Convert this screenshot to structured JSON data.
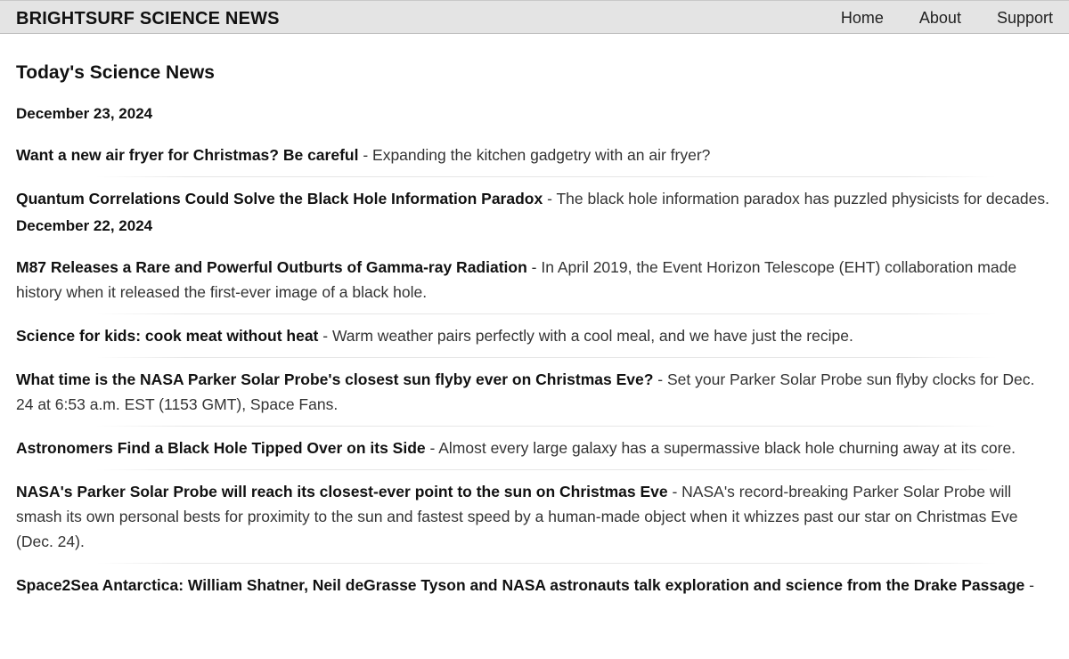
{
  "header": {
    "brand": "BRIGHTSURF SCIENCE NEWS",
    "nav": [
      "Home",
      "About",
      "Support"
    ]
  },
  "main": {
    "title": "Today's Science News",
    "groups": [
      {
        "date": "December 23, 2024",
        "articles": [
          {
            "title": "Want a new air fryer for Christmas? Be careful",
            "summary": " - Expanding the kitchen gadgetry with an air fryer?"
          },
          {
            "title": "Quantum Correlations Could Solve the Black Hole Information Paradox",
            "summary": " - The black hole information paradox has puzzled physicists for decades."
          }
        ]
      },
      {
        "date": "December 22, 2024",
        "articles": [
          {
            "title": "M87 Releases a Rare and Powerful Outburts of Gamma-ray Radiation",
            "summary": " - In April 2019, the Event Horizon Telescope (EHT) collaboration made history when it released the first-ever image of a black hole."
          },
          {
            "title": "Science for kids: cook meat without heat",
            "summary": " - Warm weather pairs perfectly with a cool meal, and we have just the recipe."
          },
          {
            "title": "What time is the NASA Parker Solar Probe's closest sun flyby ever on Christmas Eve?",
            "summary": " - Set your Parker Solar Probe sun flyby clocks for Dec. 24 at 6:53 a.m. EST (1153 GMT), Space Fans."
          },
          {
            "title": "Astronomers Find a Black Hole Tipped Over on its Side",
            "summary": " - Almost every large galaxy has a supermassive black hole churning away at its core."
          },
          {
            "title": "NASA's Parker Solar Probe will reach its closest-ever point to the sun on Christmas Eve",
            "summary": " - NASA's record-breaking Parker Solar Probe will smash its own personal bests for proximity to the sun and fastest speed by a human-made object when it whizzes past our star on Christmas Eve (Dec. 24)."
          },
          {
            "title": "Space2Sea Antarctica: William Shatner, Neil deGrasse Tyson and NASA astronauts talk exploration and science from the Drake Passage",
            "summary": " -"
          }
        ]
      }
    ]
  }
}
